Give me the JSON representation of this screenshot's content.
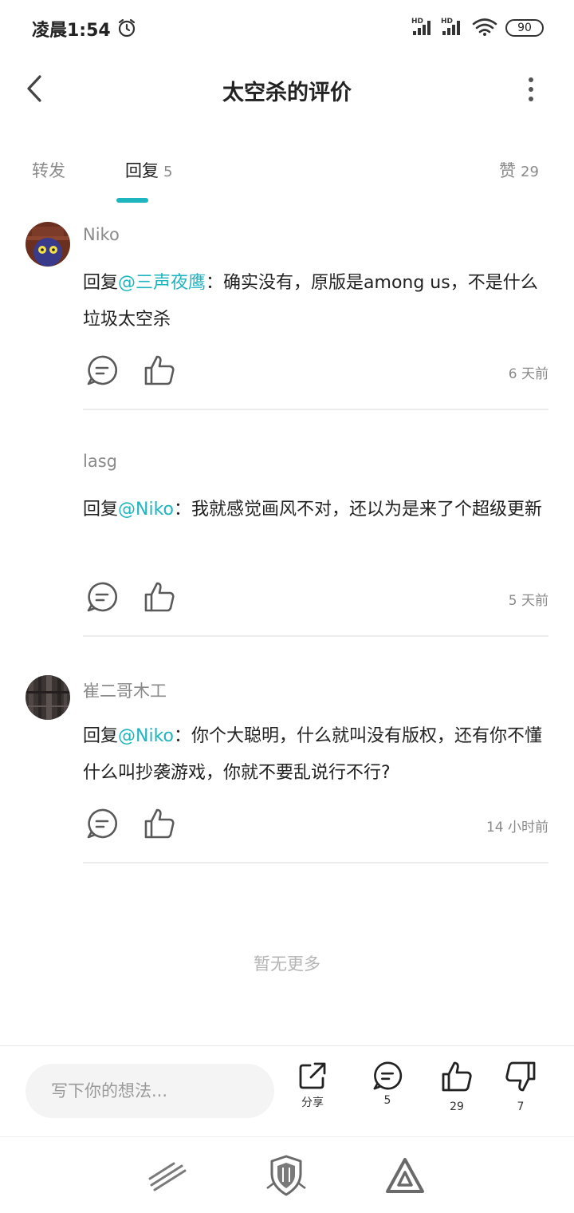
{
  "status_bar": {
    "time": "凌晨1:54",
    "battery": "90",
    "signal_1": "HD",
    "signal_2": "HD"
  },
  "header": {
    "title": "太空杀的评价"
  },
  "tabs": {
    "forward": {
      "label": "转发"
    },
    "reply": {
      "label": "回复",
      "count": "5"
    },
    "likes": {
      "label": "赞",
      "count": "29"
    }
  },
  "comments": [
    {
      "author": "Niko",
      "prefix": "回复",
      "mention": "@三声夜鹰",
      "text": "：确实没有，原版是among us，不是什么垃圾太空杀",
      "time": "6 天前"
    },
    {
      "author": "lasg",
      "prefix": "回复",
      "mention": "@Niko",
      "text": "：我就感觉画风不对，还以为是来了个超级更新",
      "time": "5 天前"
    },
    {
      "author": "崔二哥木工",
      "prefix": "回复",
      "mention": "@Niko",
      "text": "：你个大聪明，什么就叫没有版权，还有你不懂什么叫抄袭游戏，你就不要乱说行不行?",
      "time": "14 小时前"
    }
  ],
  "footer_note": "暂无更多",
  "action_bar": {
    "input_placeholder": "写下你的想法...",
    "share_label": "分享",
    "replies_count": "5",
    "likes_count": "29",
    "dislikes_count": "7"
  },
  "colors": {
    "accent": "#1fb5c0",
    "text": "#222222",
    "secondary": "#8a8a8a"
  },
  "icons": {
    "back": "chevron-left-icon",
    "more": "more-vertical-icon",
    "reply": "comment-bubble-icon",
    "like": "thumbs-up-icon",
    "dislike": "thumbs-down-icon",
    "share": "share-icon"
  }
}
